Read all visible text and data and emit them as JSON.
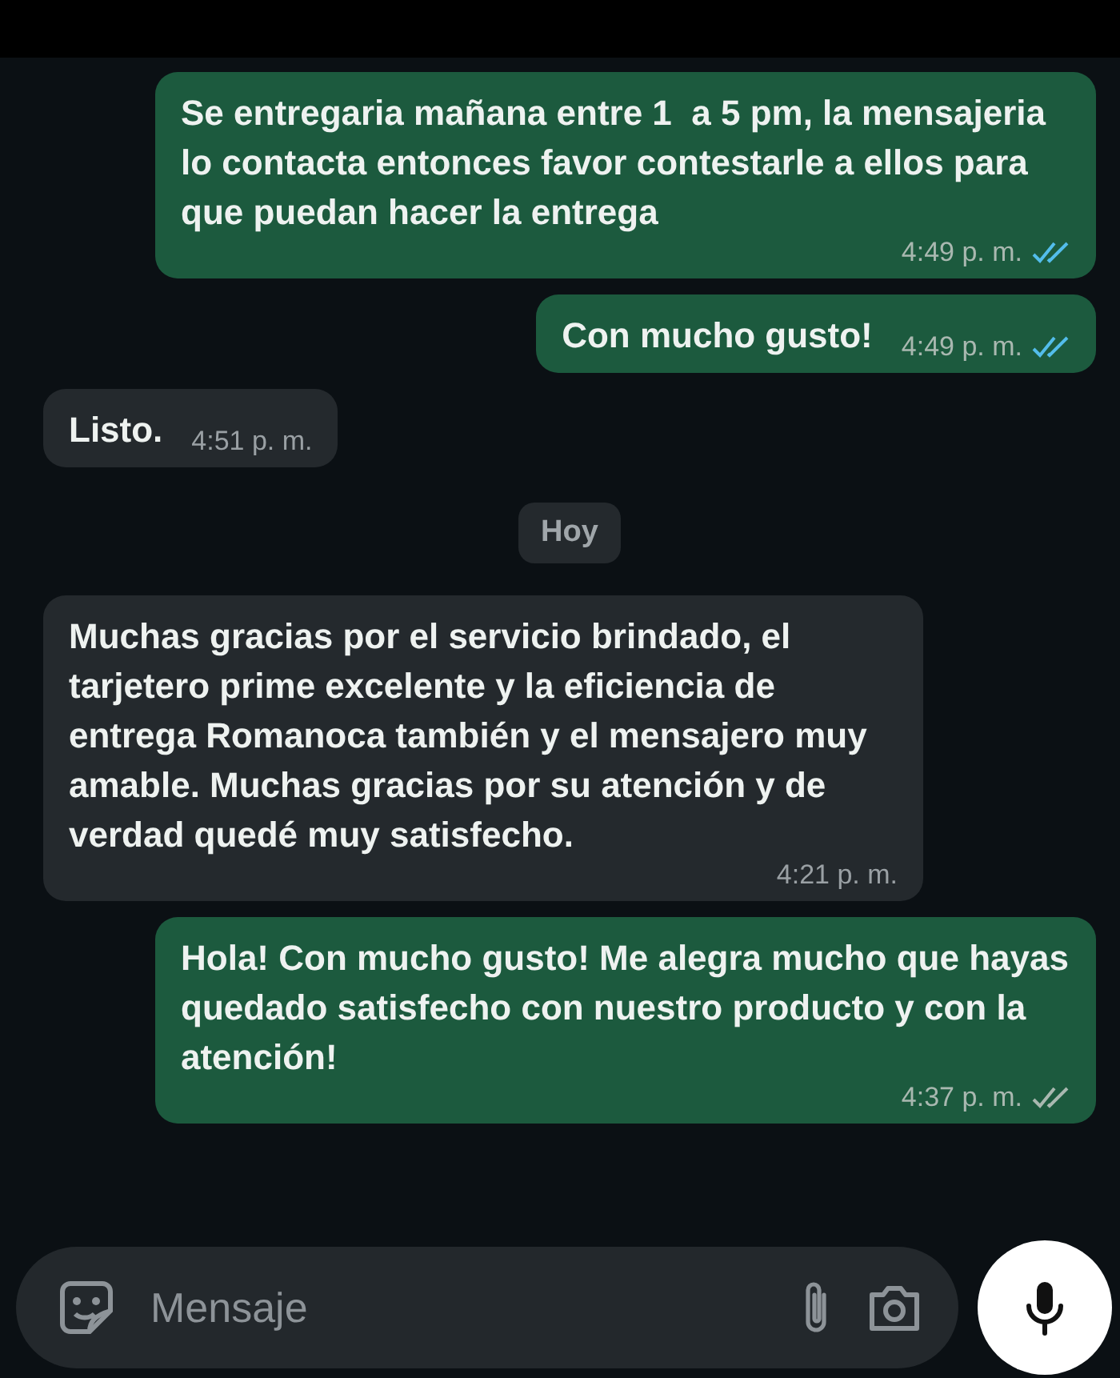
{
  "messages": [
    {
      "kind": "outgoing",
      "text": "Se entregaria mañana entre 1  a 5 pm, la mensajeria lo contacta entonces favor contestarle a ellos para que puedan hacer la entrega",
      "time": "4:49 p. m.",
      "read": true
    },
    {
      "kind": "outgoing",
      "text": "Con mucho gusto!",
      "time": "4:49 p. m.",
      "read": true
    },
    {
      "kind": "incoming",
      "text": "Listo.",
      "time": "4:51 p. m."
    },
    {
      "kind": "date",
      "text": "Hoy"
    },
    {
      "kind": "incoming",
      "text": "Muchas gracias por el servicio brindado, el tarjetero prime excelente y la eficiencia de entrega Romanoca también y el mensajero muy amable. Muchas gracias por su atención y de verdad quedé muy satisfecho.",
      "time": "4:21 p. m."
    },
    {
      "kind": "outgoing",
      "text": "Hola! Con mucho gusto! Me alegra mucho que hayas quedado satisfecho con nuestro producto y con la atención!",
      "time": "4:37 p. m.",
      "read": false
    }
  ],
  "composer": {
    "placeholder": "Mensaje"
  }
}
